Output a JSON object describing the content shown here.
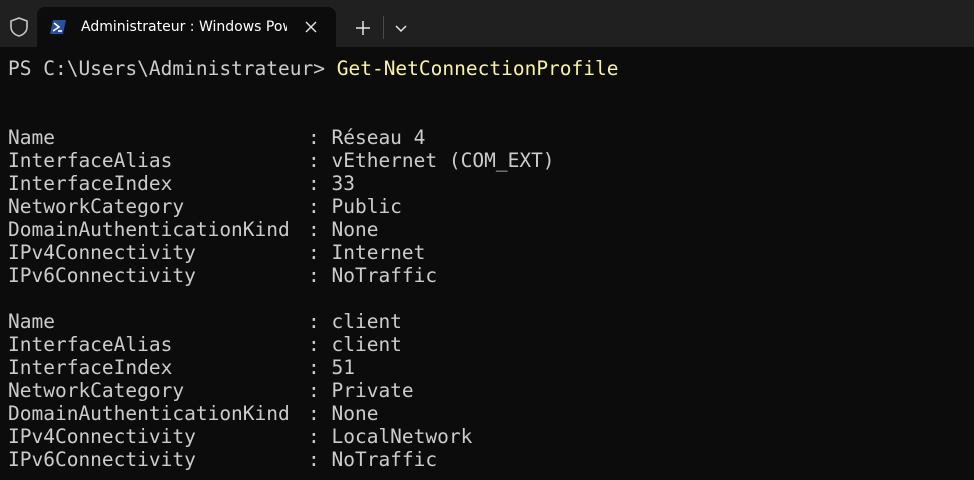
{
  "window": {
    "tab_title": "Administrateur : Windows PowerShell",
    "accent_tab_icon": "#2a4f9f"
  },
  "icons": {
    "shield": "shield-icon",
    "tab": "powershell-icon",
    "close": "close-icon",
    "new_tab": "plus-icon",
    "dropdown": "chevron-down-icon"
  },
  "terminal": {
    "prompt": "PS C:\\Users\\Administrateur> ",
    "command": "Get-NetConnectionProfile",
    "separator": ": ",
    "command_color": "#f9f1a5",
    "text_color": "#cccccc",
    "profiles": [
      {
        "rows": [
          {
            "key": "Name",
            "value": "Réseau 4"
          },
          {
            "key": "InterfaceAlias",
            "value": "vEthernet (COM_EXT)"
          },
          {
            "key": "InterfaceIndex",
            "value": "33"
          },
          {
            "key": "NetworkCategory",
            "value": "Public"
          },
          {
            "key": "DomainAuthenticationKind",
            "value": "None"
          },
          {
            "key": "IPv4Connectivity",
            "value": "Internet"
          },
          {
            "key": "IPv6Connectivity",
            "value": "NoTraffic"
          }
        ]
      },
      {
        "rows": [
          {
            "key": "Name",
            "value": "client"
          },
          {
            "key": "InterfaceAlias",
            "value": "client"
          },
          {
            "key": "InterfaceIndex",
            "value": "51"
          },
          {
            "key": "NetworkCategory",
            "value": "Private"
          },
          {
            "key": "DomainAuthenticationKind",
            "value": "None"
          },
          {
            "key": "IPv4Connectivity",
            "value": "LocalNetwork"
          },
          {
            "key": "IPv6Connectivity",
            "value": "NoTraffic"
          }
        ]
      }
    ]
  }
}
